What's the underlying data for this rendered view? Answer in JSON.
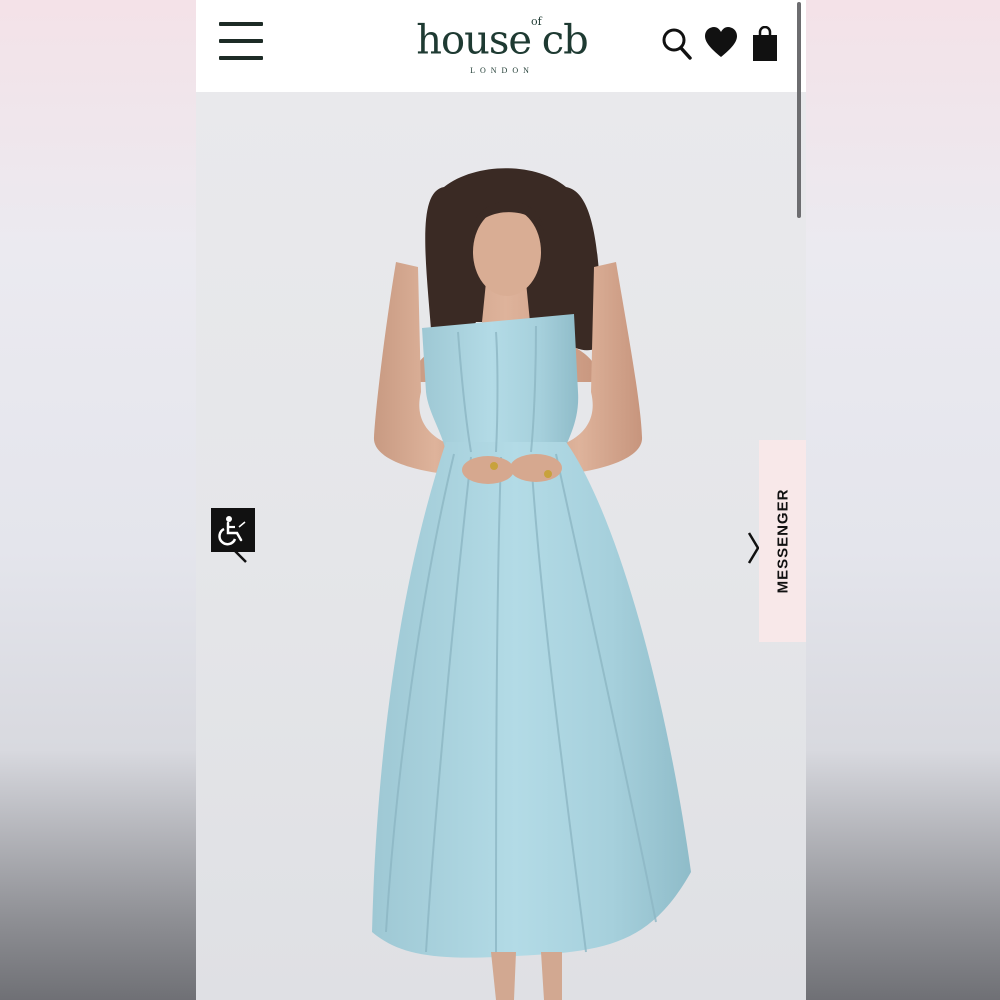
{
  "brand": {
    "logo_main": "house",
    "logo_of": "of",
    "logo_suffix": "cb",
    "logo_sub": "LONDON",
    "color": "#1e3a32"
  },
  "header": {
    "menu_icon": "hamburger-menu-icon",
    "icons": [
      "search-icon",
      "heart-icon",
      "shopping-bag-icon"
    ]
  },
  "product_image": {
    "dress_color": "#a9d3df",
    "background": "#e6e7ea"
  },
  "accessibility": {
    "icon": "wheelchair-icon"
  },
  "messenger": {
    "label": "MESSENGER",
    "background": "#f8e8e9"
  }
}
